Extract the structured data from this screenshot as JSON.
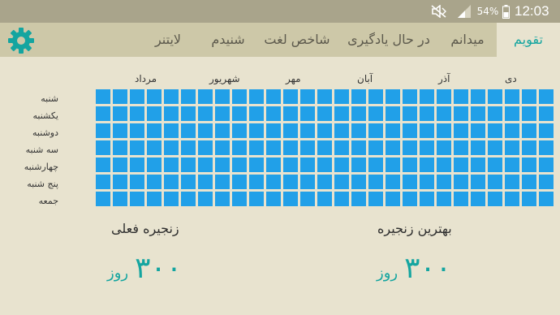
{
  "status_bar": {
    "battery_pct": "54%",
    "clock": "12:03",
    "icons": [
      "mute-icon",
      "signal-icon",
      "battery-icon"
    ]
  },
  "tabs": [
    {
      "label": "تقویم",
      "active": true
    },
    {
      "label": "میدانم",
      "active": false
    },
    {
      "label": "در حال یادگیری",
      "active": false
    },
    {
      "label": "شاخص لغت",
      "active": false
    },
    {
      "label": "شنیدم",
      "active": false
    },
    {
      "label": "لایتنر",
      "active": false
    }
  ],
  "calendar": {
    "months": [
      "دی",
      "آذر",
      "آبان",
      "مهر",
      "شهریور",
      "مرداد"
    ],
    "days": [
      "شنبه",
      "یکشنبه",
      "دوشنبه",
      "سه شنبه",
      "چهارشنبه",
      "پنج شنبه",
      "جمعه"
    ],
    "weeks": 27,
    "cell_color": "#21a0e8"
  },
  "best_streak": {
    "title": "بهترین زنجیره",
    "value": "۳۰۰",
    "unit": "روز"
  },
  "current_streak": {
    "title": "زنجیره فعلی",
    "value": "۳۰۰",
    "unit": "روز"
  },
  "colors": {
    "accent": "#14a5a0",
    "status_bar": "#a9a48b",
    "toolbar": "#cdc8a8",
    "background": "#e8e3cf"
  }
}
